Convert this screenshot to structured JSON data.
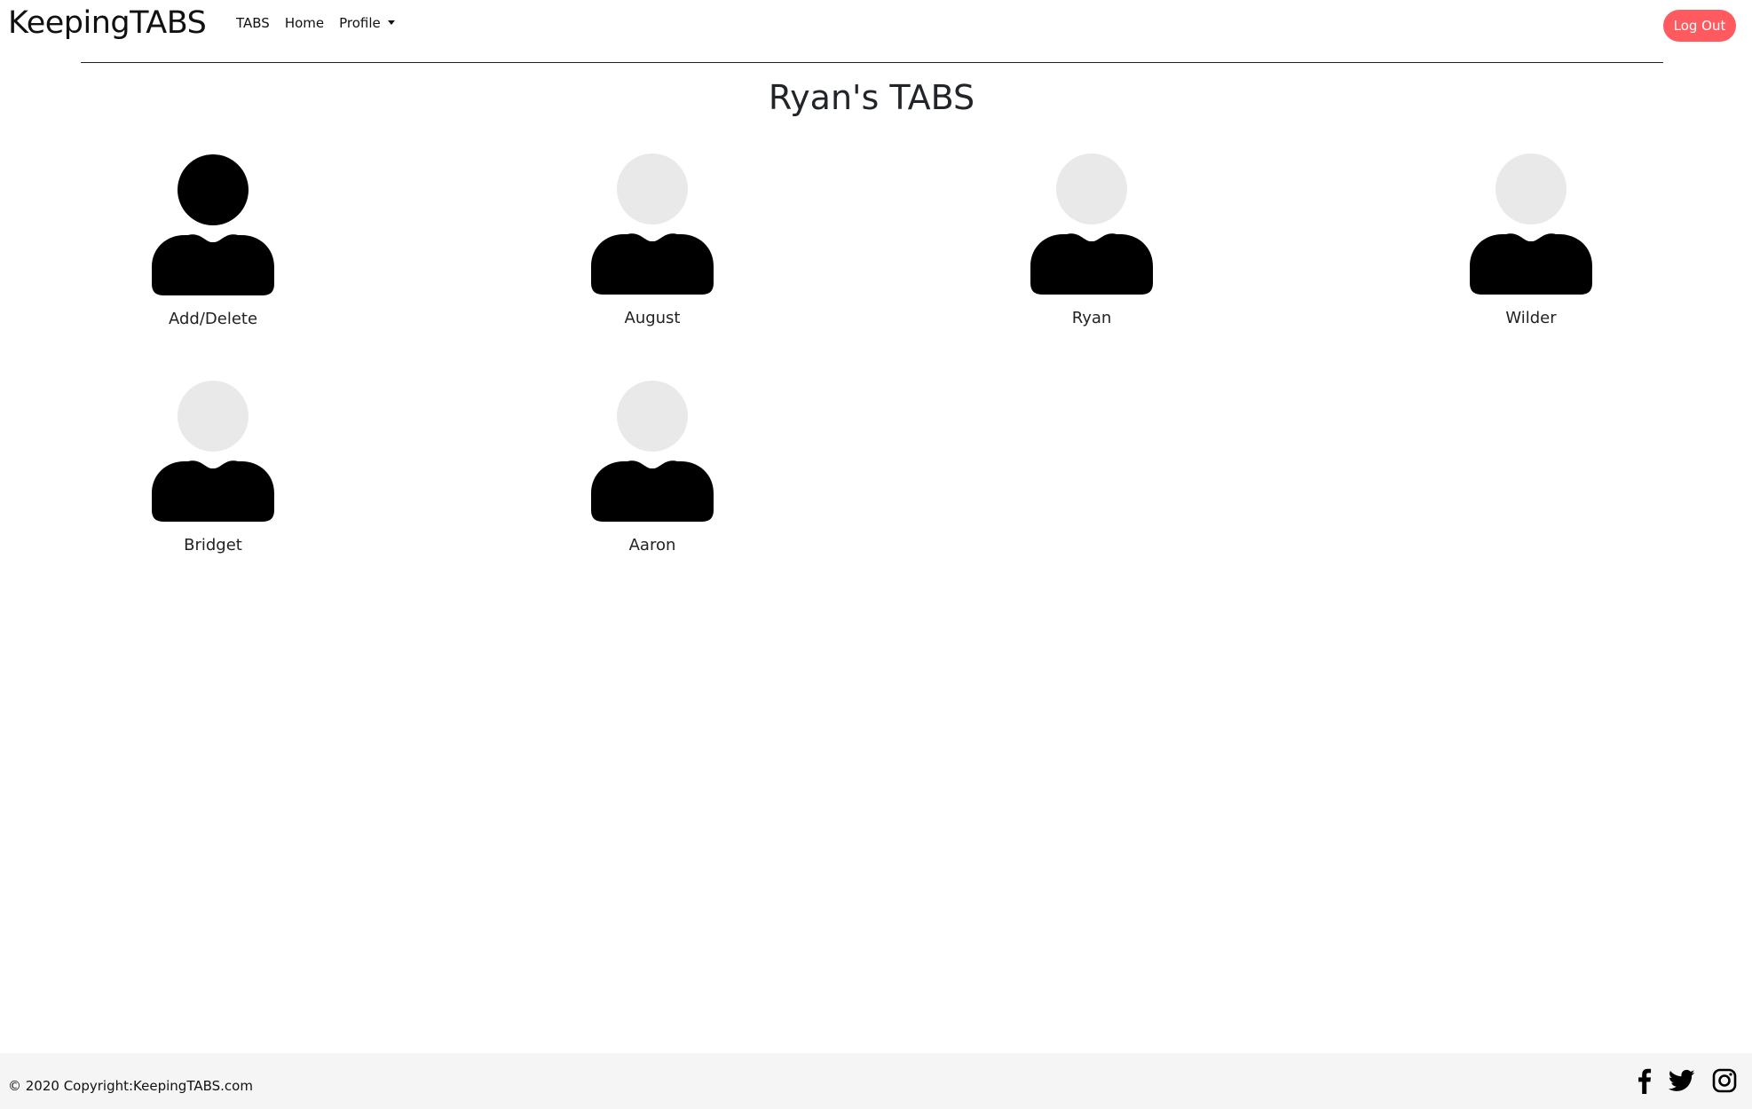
{
  "brand": "KeepingTABS",
  "nav": {
    "tabs_label": "TABS",
    "home_label": "Home",
    "profile_label": "Profile",
    "logout_label": "Log Out"
  },
  "page": {
    "title": "Ryan's TABS"
  },
  "tabs": [
    {
      "label": "Add/Delete",
      "icon": "user-icon",
      "head_color": "#000000"
    },
    {
      "label": "August",
      "icon": "user-icon",
      "head_color": "#e9e9e9"
    },
    {
      "label": "Ryan",
      "icon": "user-icon",
      "head_color": "#e9e9e9"
    },
    {
      "label": "Wilder",
      "icon": "user-icon",
      "head_color": "#e9e9e9"
    },
    {
      "label": "Bridget",
      "icon": "user-icon",
      "head_color": "#e9e9e9"
    },
    {
      "label": "Aaron",
      "icon": "user-icon",
      "head_color": "#e9e9e9"
    }
  ],
  "footer": {
    "copyright": "© 2020 Copyright:KeepingTABS.com",
    "social_icons": [
      "facebook-icon",
      "twitter-icon",
      "instagram-icon"
    ]
  },
  "colors": {
    "accent": "#ff5a5f",
    "footer_bg": "#f5f5f5",
    "body_color": "#000000"
  }
}
